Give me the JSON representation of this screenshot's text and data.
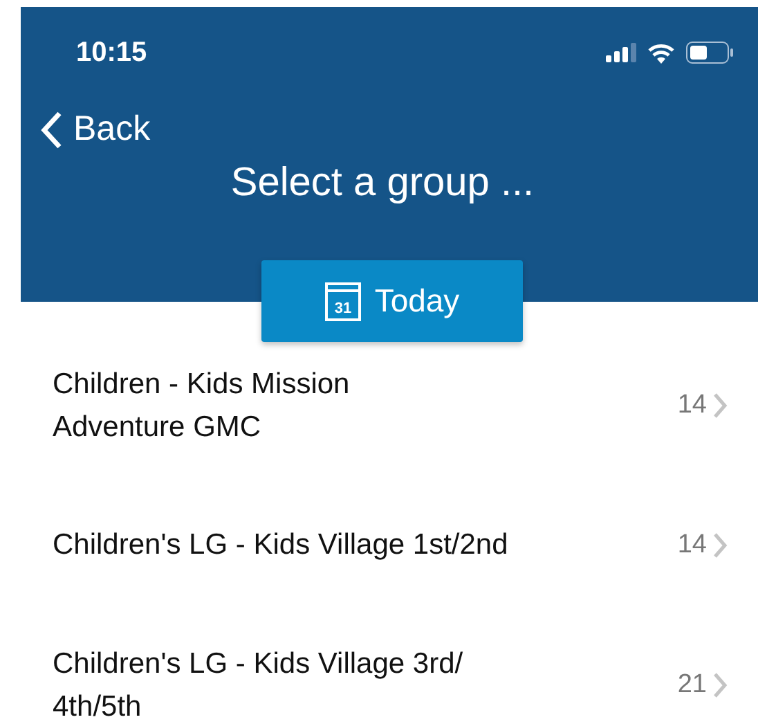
{
  "status_bar": {
    "time": "10:15"
  },
  "nav": {
    "back": "Back",
    "title": "Select a group ...",
    "today_button": {
      "label": "Today",
      "calendar_day": "31"
    }
  },
  "groups": [
    {
      "lines": [
        "Children - Kids Mission",
        "Adventure GMC"
      ],
      "count": "14"
    },
    {
      "lines": [
        "Children's LG - Kids Village 1st/2nd"
      ],
      "count": "14"
    },
    {
      "lines": [
        "Children's LG - Kids Village 3rd/",
        "4th/5th"
      ],
      "count": "21"
    }
  ]
}
